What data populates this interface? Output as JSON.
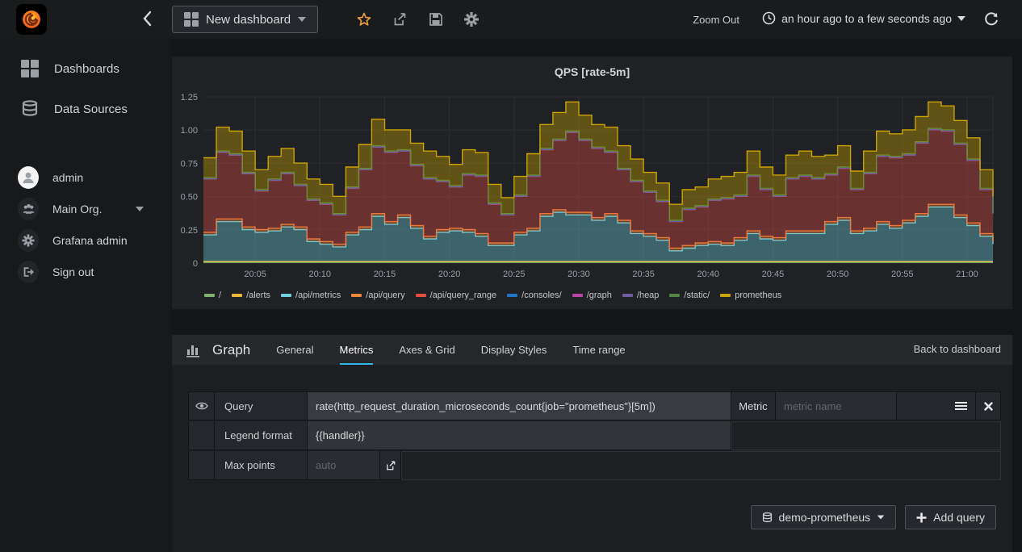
{
  "topbar": {
    "dashboard_title": "New dashboard",
    "zoom_out_label": "Zoom Out",
    "time_range_label": "an hour ago to a few seconds ago"
  },
  "sidebar": {
    "items": [
      {
        "label": "Dashboards",
        "icon": "grid-icon"
      },
      {
        "label": "Data Sources",
        "icon": "database-icon"
      }
    ],
    "user_items": [
      {
        "label": "admin",
        "icon": "user-avatar-icon"
      },
      {
        "label": "Main Org.",
        "icon": "org-users-icon",
        "has_caret": true
      },
      {
        "label": "Grafana admin",
        "icon": "gear-icon"
      },
      {
        "label": "Sign out",
        "icon": "sign-out-icon"
      }
    ]
  },
  "editor": {
    "panel_type": "Graph",
    "tabs": [
      {
        "label": "General",
        "active": false
      },
      {
        "label": "Metrics",
        "active": true
      },
      {
        "label": "Axes & Grid",
        "active": false
      },
      {
        "label": "Display Styles",
        "active": false
      },
      {
        "label": "Time range",
        "active": false
      }
    ],
    "back_link": "Back to dashboard",
    "query_row": {
      "label": "Query",
      "value": "rate(http_request_duration_microseconds_count{job=\"prometheus\"}[5m])",
      "metric_label": "Metric",
      "metric_placeholder": "metric name"
    },
    "legend_row": {
      "label": "Legend format",
      "value": "{{handler}}"
    },
    "max_points_row": {
      "label": "Max points",
      "placeholder": "auto"
    },
    "datasource_button": "demo-prometheus",
    "add_query_button": "Add query"
  },
  "icons": {
    "topbar": [
      "grafana-logo",
      "back-chevron-icon",
      "grid-icon",
      "caret-down-icon",
      "star-icon",
      "share-icon",
      "save-icon",
      "gear-icon",
      "clock-icon",
      "refresh-icon"
    ],
    "editor": [
      "bar-chart-icon",
      "eye-icon",
      "menu-icon",
      "close-icon",
      "external-link-icon",
      "database-icon",
      "plus-icon"
    ]
  },
  "colors": {
    "accent": "#33b5e5",
    "star": "#eb9e3e",
    "panel_bg": "#1f2124",
    "grid": "#2b2d31"
  },
  "chart_data": {
    "type": "area",
    "stacked": true,
    "title": "QPS [rate-5m]",
    "legend_position": "bottom",
    "grid": true,
    "x_start": "20:01",
    "x_step_minutes": 1,
    "n_points": 62,
    "ylim": [
      0,
      1.25
    ],
    "y_ticks": [
      {
        "v": 0,
        "label": "0"
      },
      {
        "v": 0.25,
        "label": "0.25"
      },
      {
        "v": 0.5,
        "label": "0.50"
      },
      {
        "v": 0.75,
        "label": "0.75"
      },
      {
        "v": 1.0,
        "label": "1.00"
      },
      {
        "v": 1.25,
        "label": "1.25"
      }
    ],
    "x_ticks": [
      {
        "minute": 5,
        "label": "20:05"
      },
      {
        "minute": 10,
        "label": "20:10"
      },
      {
        "minute": 15,
        "label": "20:15"
      },
      {
        "minute": 20,
        "label": "20:20"
      },
      {
        "minute": 25,
        "label": "20:25"
      },
      {
        "minute": 30,
        "label": "20:30"
      },
      {
        "minute": 35,
        "label": "20:35"
      },
      {
        "minute": 40,
        "label": "20:40"
      },
      {
        "minute": 45,
        "label": "20:45"
      },
      {
        "minute": 50,
        "label": "20:50"
      },
      {
        "minute": 55,
        "label": "20:55"
      },
      {
        "minute": 60,
        "label": "21:00"
      }
    ],
    "series": [
      {
        "name": "/",
        "color": "#7EB26D",
        "const": 0.006
      },
      {
        "name": "/alerts",
        "color": "#EAB839",
        "const": 0.006
      },
      {
        "name": "/api/metrics",
        "color": "#6ED0E0",
        "values": [
          0.2,
          0.3,
          0.3,
          0.24,
          0.22,
          0.23,
          0.26,
          0.24,
          0.15,
          0.13,
          0.11,
          0.2,
          0.24,
          0.34,
          0.28,
          0.33,
          0.25,
          0.17,
          0.22,
          0.23,
          0.22,
          0.19,
          0.12,
          0.12,
          0.2,
          0.23,
          0.34,
          0.37,
          0.35,
          0.35,
          0.31,
          0.34,
          0.29,
          0.21,
          0.19,
          0.16,
          0.08,
          0.1,
          0.12,
          0.13,
          0.12,
          0.16,
          0.21,
          0.17,
          0.16,
          0.21,
          0.21,
          0.21,
          0.28,
          0.31,
          0.21,
          0.23,
          0.28,
          0.25,
          0.29,
          0.34,
          0.41,
          0.41,
          0.33,
          0.27,
          0.19,
          0.13
        ]
      },
      {
        "name": "/api/query",
        "color": "#EF843C",
        "const": 0.02
      },
      {
        "name": "/api/query_range",
        "color": "#E24D42",
        "values": [
          0.4,
          0.5,
          0.48,
          0.4,
          0.29,
          0.36,
          0.38,
          0.31,
          0.29,
          0.28,
          0.22,
          0.33,
          0.43,
          0.5,
          0.52,
          0.48,
          0.45,
          0.43,
          0.36,
          0.31,
          0.41,
          0.43,
          0.29,
          0.21,
          0.27,
          0.39,
          0.48,
          0.52,
          0.6,
          0.54,
          0.52,
          0.46,
          0.38,
          0.37,
          0.31,
          0.27,
          0.2,
          0.27,
          0.27,
          0.31,
          0.33,
          0.31,
          0.41,
          0.35,
          0.31,
          0.39,
          0.41,
          0.39,
          0.35,
          0.37,
          0.31,
          0.41,
          0.49,
          0.51,
          0.49,
          0.53,
          0.56,
          0.55,
          0.53,
          0.47,
          0.33,
          0.21
        ]
      },
      {
        "name": "/consoles/",
        "color": "#1F78C1",
        "const": 0.002
      },
      {
        "name": "/graph",
        "color": "#BA43A9",
        "const": 0.002
      },
      {
        "name": "/heap",
        "color": "#705DA0",
        "const": 0.002
      },
      {
        "name": "/static/",
        "color": "#508642",
        "const": 0.004
      },
      {
        "name": "prometheus",
        "color": "#CCA300",
        "values": [
          0.15,
          0.18,
          0.17,
          0.16,
          0.15,
          0.17,
          0.18,
          0.16,
          0.15,
          0.14,
          0.13,
          0.15,
          0.18,
          0.2,
          0.16,
          0.15,
          0.16,
          0.2,
          0.18,
          0.16,
          0.18,
          0.17,
          0.14,
          0.12,
          0.14,
          0.16,
          0.18,
          0.2,
          0.22,
          0.18,
          0.17,
          0.18,
          0.17,
          0.16,
          0.14,
          0.13,
          0.12,
          0.14,
          0.14,
          0.15,
          0.16,
          0.17,
          0.18,
          0.16,
          0.15,
          0.17,
          0.18,
          0.16,
          0.14,
          0.16,
          0.13,
          0.16,
          0.18,
          0.17,
          0.18,
          0.19,
          0.2,
          0.18,
          0.17,
          0.16,
          0.14,
          0.12
        ]
      }
    ]
  }
}
